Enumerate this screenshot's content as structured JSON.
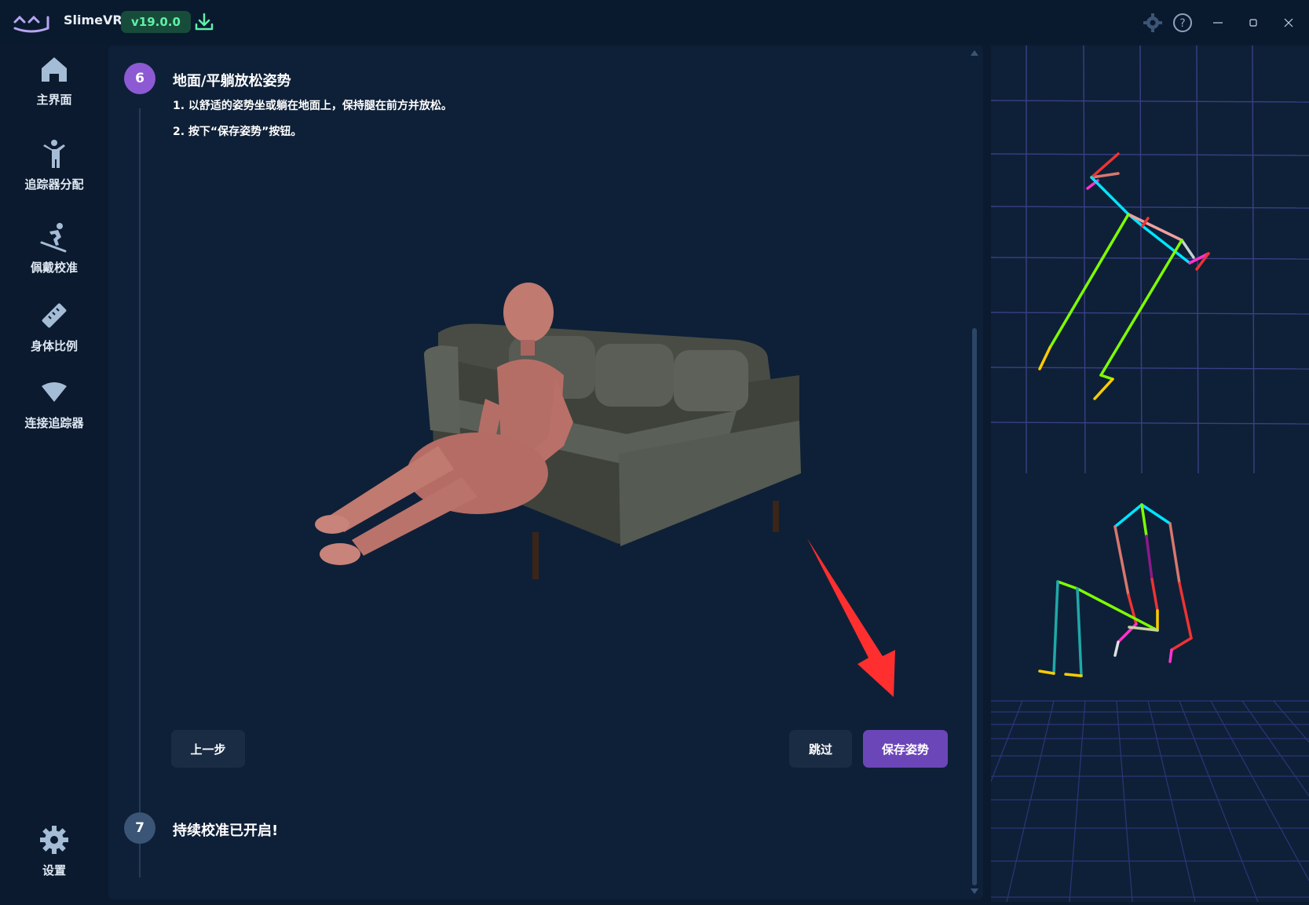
{
  "app": {
    "title": "SlimeVR",
    "version": "v19.0.0"
  },
  "sidebar": {
    "items": [
      {
        "label": "主界面",
        "icon": "home-icon"
      },
      {
        "label": "追踪器分配",
        "icon": "person-icon"
      },
      {
        "label": "佩戴校准",
        "icon": "skier-icon"
      },
      {
        "label": "身体比例",
        "icon": "ruler-icon"
      },
      {
        "label": "连接追踪器",
        "icon": "wifi-icon"
      }
    ],
    "settings_label": "设置"
  },
  "steps": {
    "current": {
      "number": "6",
      "title": "地面/平躺放松姿势",
      "line1": "1. 以舒适的姿势坐或躺在地面上，保持腿在前方并放松。",
      "line2": "2. 按下“保存姿势”按钮。"
    },
    "next": {
      "number": "7",
      "title": "持续校准已开启!"
    }
  },
  "buttons": {
    "back": "上一步",
    "skip": "跳过",
    "save": "保存姿势"
  },
  "colors": {
    "accent": "#6b46b8",
    "step_active": "#8d5ad4",
    "step_inactive": "#3b5577",
    "background": "#0b1a2e",
    "panel": "#0e2037",
    "version_badge_text": "#5ff0a7",
    "arrow": "#ff3333"
  }
}
